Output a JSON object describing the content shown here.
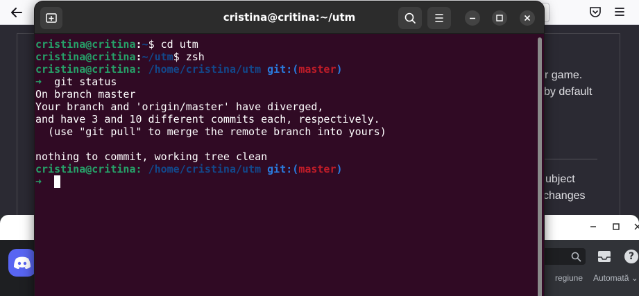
{
  "terminal": {
    "title": "cristina@critina:~/utm",
    "lines": [
      [
        {
          "t": "cristina@critina",
          "c": "c-green"
        },
        {
          "t": ":",
          "c": "c-white"
        },
        {
          "t": "~",
          "c": "c-blue"
        },
        {
          "t": "$ cd utm",
          "c": "c-plain"
        }
      ],
      [
        {
          "t": "cristina@critina",
          "c": "c-green"
        },
        {
          "t": ":",
          "c": "c-white"
        },
        {
          "t": "~/utm",
          "c": "c-blue"
        },
        {
          "t": "$ zsh",
          "c": "c-plain"
        }
      ],
      [
        {
          "t": "cristina@critina: ",
          "c": "c-green"
        },
        {
          "t": "/home/cristina/utm ",
          "c": "c-blue"
        },
        {
          "t": "git:(",
          "c": "c-bblue"
        },
        {
          "t": "master",
          "c": "c-red"
        },
        {
          "t": ")",
          "c": "c-bblue"
        }
      ],
      [
        {
          "t": "➜  ",
          "c": "c-arrow"
        },
        {
          "t": "git status",
          "c": "c-plain"
        }
      ],
      [
        {
          "t": "On branch master",
          "c": "c-plain"
        }
      ],
      [
        {
          "t": "Your branch and 'origin/master' have diverged,",
          "c": "c-plain"
        }
      ],
      [
        {
          "t": "and have 3 and 10 different commits each, respectively.",
          "c": "c-plain"
        }
      ],
      [
        {
          "t": "  (use \"git pull\" to merge the remote branch into yours)",
          "c": "c-plain"
        }
      ],
      [
        {
          "t": "",
          "c": "c-plain"
        }
      ],
      [
        {
          "t": "nothing to commit, working tree clean",
          "c": "c-plain"
        }
      ],
      [
        {
          "t": "cristina@critina: ",
          "c": "c-green"
        },
        {
          "t": "/home/cristina/utm ",
          "c": "c-blue"
        },
        {
          "t": "git:(",
          "c": "c-bblue"
        },
        {
          "t": "master",
          "c": "c-red"
        },
        {
          "t": ")",
          "c": "c-bblue"
        }
      ],
      [
        {
          "t": "➜  ",
          "c": "c-arrow"
        }
      ]
    ],
    "cursor_line": 11
  },
  "background_browser": {
    "fragments": [
      "r game.",
      "by default",
      "ubject",
      "changes"
    ]
  },
  "background_app": {
    "fragments": [
      "regiune",
      "Automată"
    ],
    "dropdown_glyph": "⌄"
  },
  "icons": {
    "terminal_new_tab": "new-tab-icon",
    "terminal_search": "search-icon",
    "terminal_menu": "hamburger-menu-icon",
    "window_min": "minimize-icon",
    "window_max": "maximize-icon",
    "window_close": "close-icon",
    "browser_back": "back-arrow-icon",
    "browser_pocket": "pocket-icon",
    "browser_menu": "hamburger-menu-icon",
    "app_logo": "discord-icon",
    "app_inbox": "inbox-icon",
    "app_help": "help-icon"
  },
  "colors": {
    "terminal_bg": "#300a24",
    "prompt_user": "#26a269",
    "prompt_path": "#12488b",
    "git_branch": "#c01c28",
    "header_bg": "#2c2c2c"
  }
}
